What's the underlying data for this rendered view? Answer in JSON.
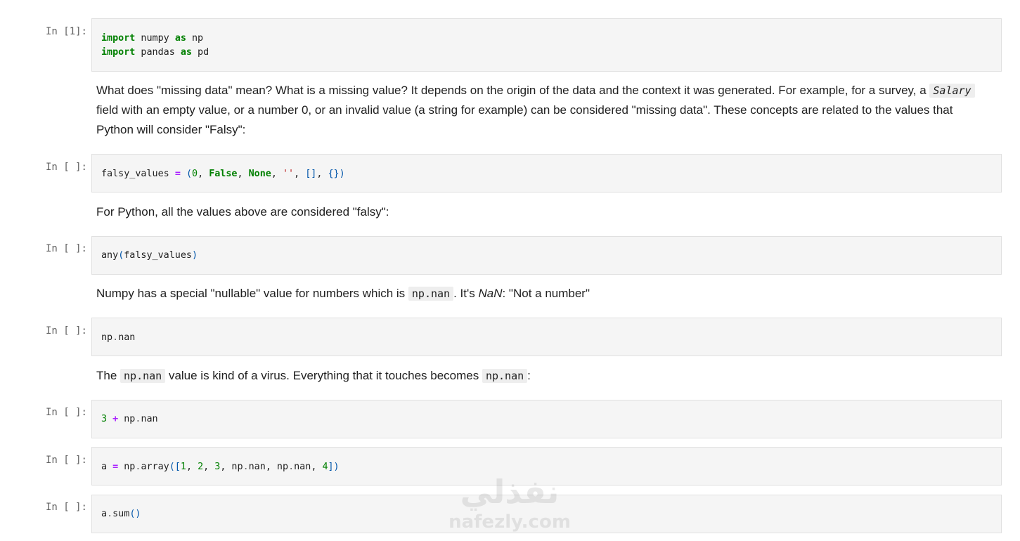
{
  "cells": {
    "c1": {
      "prompt": "In [1]:"
    },
    "c2": {
      "prompt": "In [ ]:"
    },
    "c3": {
      "prompt": "In [ ]:"
    },
    "c4": {
      "prompt": "In [ ]:"
    },
    "c5": {
      "prompt": "In [ ]:"
    },
    "c6": {
      "prompt": "In [ ]:"
    },
    "c7": {
      "prompt": "In [ ]:"
    }
  },
  "code": {
    "c1": {
      "l1": [
        "import",
        " numpy ",
        "as",
        " np"
      ],
      "l2": [
        "import",
        " pandas ",
        "as",
        " pd"
      ]
    },
    "c2": [
      "falsy_values ",
      "=",
      " ",
      "(",
      "0",
      ", ",
      "False",
      ", ",
      "None",
      ", ",
      "''",
      ", ",
      "[]",
      ", ",
      "{}",
      ")"
    ],
    "c3": [
      "any",
      "(",
      "falsy_values",
      ")"
    ],
    "c4": [
      "np",
      ".",
      "nan"
    ],
    "c5": [
      "3",
      " ",
      "+",
      " np",
      ".",
      "nan"
    ],
    "c6": [
      "a ",
      "=",
      " np",
      ".",
      "array",
      "([",
      "1",
      ", ",
      "2",
      ", ",
      "3",
      ", np",
      ".",
      "nan",
      ", np",
      ".",
      "nan",
      ", ",
      "4",
      "])"
    ],
    "c7": [
      "a",
      ".",
      "sum",
      "()"
    ]
  },
  "markdown": {
    "m1": {
      "t1": "What does \"missing data\" mean? What is a missing value? It depends on the origin of the data and the context it was generated. For example, for a survey, a ",
      "code": "Salary",
      "t2": " field with an empty value, or a number 0, or an invalid value (a string for example) can be considered \"missing data\". These concepts are related to the values that Python will consider \"Falsy\":"
    },
    "m2": {
      "text": "For Python, all the values above are considered \"falsy\":"
    },
    "m3": {
      "t1": "Numpy has a special \"nullable\" value for numbers which is ",
      "code": "np.nan",
      "t2": ". It's ",
      "em": "NaN",
      "t3": ": \"Not a number\""
    },
    "m4": {
      "t1": "The ",
      "code1": "np.nan",
      "t2": " value is kind of a virus. Everything that it touches becomes ",
      "code2": "np.nan",
      "t3": ":"
    }
  },
  "watermark": {
    "arabic": "نفذلي",
    "latin": "nafezly.com"
  }
}
